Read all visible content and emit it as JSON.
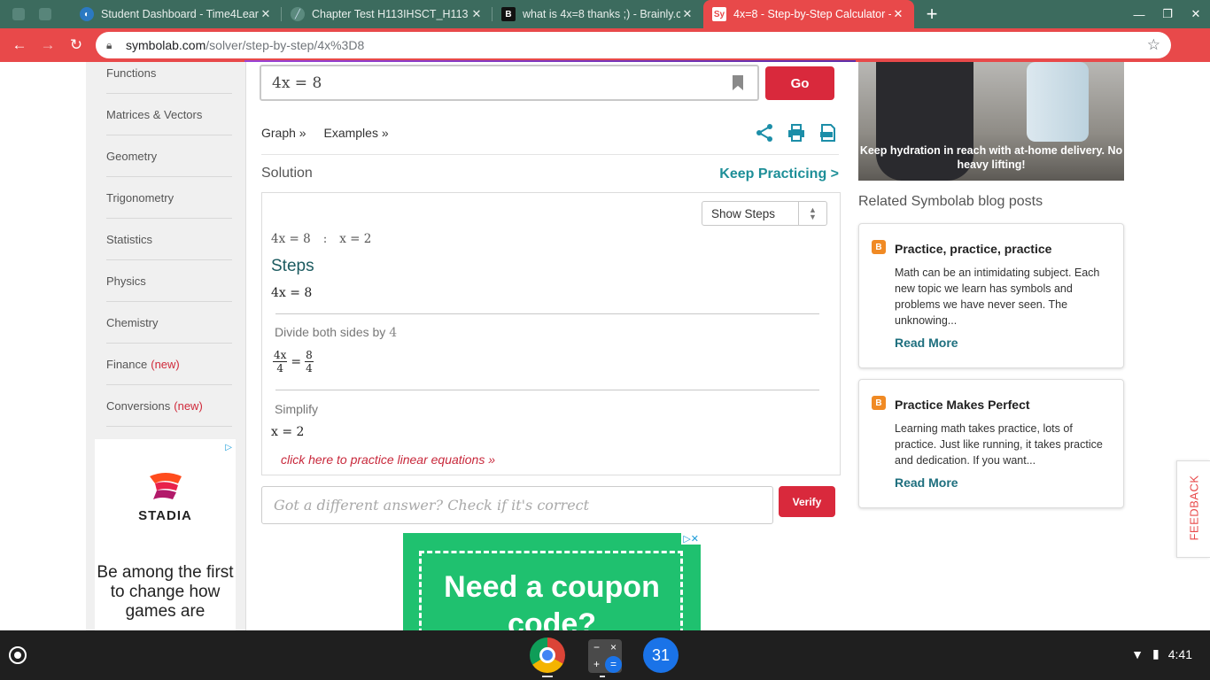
{
  "tabs": [
    {
      "title": "Student Dashboard - Time4Lear",
      "icon": "time4learning-favicon-icon"
    },
    {
      "title": "Chapter Test H113IHSCT_H113",
      "icon": "document-favicon-icon"
    },
    {
      "title": "what is 4x=8 thanks ;) - Brainly.c",
      "icon": "brainly-favicon-icon"
    },
    {
      "title": "4x=8 - Step-by-Step Calculator -",
      "icon": "symbolab-favicon-icon",
      "fav_text": "Sy",
      "active": true
    }
  ],
  "address": {
    "host": "symbolab.com",
    "path": "/solver/step-by-step/4x%3D8"
  },
  "sidebar": {
    "items": [
      {
        "label": "Functions",
        "tag": ""
      },
      {
        "label": "Matrices & Vectors",
        "tag": ""
      },
      {
        "label": "Geometry",
        "tag": ""
      },
      {
        "label": "Trigonometry",
        "tag": ""
      },
      {
        "label": "Statistics",
        "tag": ""
      },
      {
        "label": "Physics",
        "tag": ""
      },
      {
        "label": "Chemistry",
        "tag": ""
      },
      {
        "label": "Finance",
        "tag": "(new)"
      },
      {
        "label": "Conversions",
        "tag": "(new)"
      }
    ]
  },
  "ad_stadia": {
    "brand": "STADIA",
    "pitch": "Be among the first to change how games are"
  },
  "search": {
    "query": "4x = 8",
    "go_label": "Go"
  },
  "links": {
    "graph": "Graph »",
    "examples": "Examples »"
  },
  "solution": {
    "label": "Solution",
    "keep_practicing": "Keep Practicing >",
    "show_steps": "Show Steps",
    "answer_lhs": "4x = 8",
    "answer_sep": ":",
    "answer_rhs": "x = 2",
    "steps_title": "Steps",
    "step0": "4x = 8",
    "divide_label": "Divide both sides by",
    "divide_value": "4",
    "frac_l_num": "4x",
    "frac_l_den": "4",
    "frac_r_num": "8",
    "frac_r_den": "4",
    "simplify_label": "Simplify",
    "simplify_eq": "x = 2",
    "practice_link": "click here to practice linear equations »"
  },
  "verify": {
    "placeholder": "Got a different answer? Check if it's correct",
    "button": "Verify"
  },
  "ad_coupon": {
    "text": "Need a coupon code?"
  },
  "ad_hydration": {
    "caption": "Keep hydration in reach with at-home delivery. No heavy lifting!"
  },
  "related": {
    "heading": "Related Symbolab blog posts",
    "posts": [
      {
        "title": "Practice, practice, practice",
        "body": "Math can be an intimidating subject. Each new topic we learn has symbols and problems we have never seen. The unknowing...",
        "more": "Read More"
      },
      {
        "title": "Practice Makes Perfect",
        "body": "Learning math takes practice, lots of practice. Just like running, it takes practice and dedication. If you want...",
        "more": "Read More"
      }
    ]
  },
  "feedback": "FEEDBACK",
  "shelf": {
    "calendar_day": "31",
    "time": "4:41"
  },
  "colors": {
    "brand_red": "#e8494a",
    "button_red": "#d9293c",
    "teal": "#1e8f98",
    "tab_bar": "#3c6b5e"
  }
}
